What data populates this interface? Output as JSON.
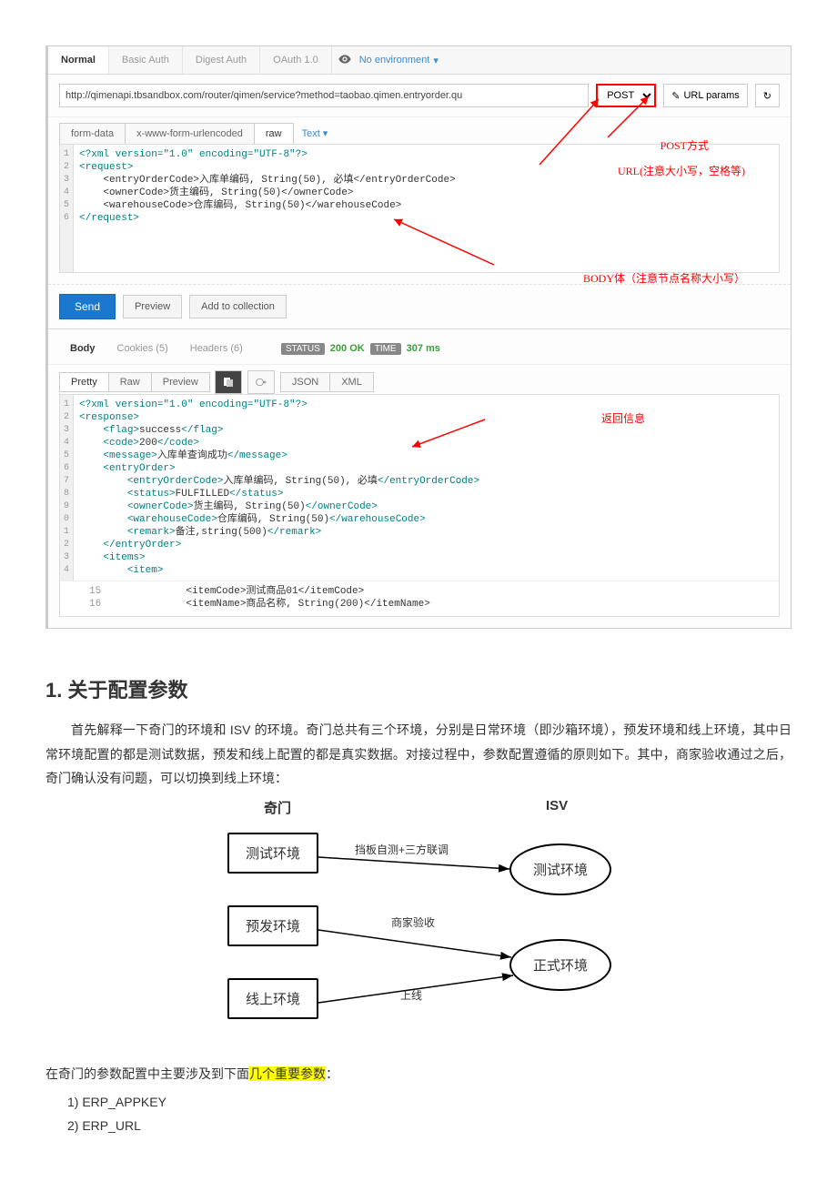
{
  "postman": {
    "tabs": {
      "normal": "Normal",
      "basic": "Basic Auth",
      "digest": "Digest Auth",
      "oauth": "OAuth 1.0"
    },
    "env": "No environment",
    "url": "http://qimenapi.tbsandbox.com/router/qimen/service?method=taobao.qimen.entryorder.qu",
    "method": "POST",
    "url_params_btn": "URL params",
    "body_tabs": {
      "form": "form-data",
      "urlenc": "x-www-form-urlencoded",
      "raw": "raw"
    },
    "body_type": "Text",
    "request_xml": {
      "decl": "<?xml version=\"1.0\" encoding=\"UTF-8\"?>",
      "l2": "<request>",
      "l3": "    <entryOrderCode>入库单编码, String(50), 必填</entryOrderCode>",
      "l4": "    <ownerCode>货主编码, String(50)</ownerCode>",
      "l5": "    <warehouseCode>仓库编码, String(50)</warehouseCode>",
      "l6": "</request>"
    },
    "send": "Send",
    "preview": "Preview",
    "add": "Add to collection",
    "resp_tabs": {
      "body": "Body",
      "cookies": "Cookies (5)",
      "headers": "Headers (6)"
    },
    "status_label": "STATUS",
    "status": "200 OK",
    "time_label": "TIME",
    "time": "307 ms",
    "fmt_tabs": {
      "pretty": "Pretty",
      "raw": "Raw",
      "preview": "Preview",
      "json": "JSON",
      "xml": "XML"
    },
    "response_xml_lines": [
      "<?xml version=\"1.0\" encoding=\"UTF-8\"?>",
      "<response>",
      "    <flag>success</flag>",
      "    <code>200</code>",
      "    <message>入库单查询成功</message>",
      "    <entryOrder>",
      "        <entryOrderCode>入库单编码, String(50), 必填</entryOrderCode>",
      "        <status>FULFILLED</status>",
      "        <ownerCode>货主编码, String(50)</ownerCode>",
      "        <warehouseCode>仓库编码, String(50)</warehouseCode>",
      "        <remark>备注,string(500)</remark>",
      "    </entryOrder>",
      "    <items>",
      "        <item>"
    ],
    "response_extra": [
      "            <itemCode>测试商品01</itemCode>",
      "            <itemName>商品名称, String(200)</itemName>"
    ],
    "response_extra_nums": [
      "15",
      "16"
    ]
  },
  "annotations": {
    "post": "POST方式",
    "url": "URL(注意大小写，空格等)",
    "body": "BODY体（注意节点名称大小写）",
    "resp": "返回信息"
  },
  "doc": {
    "h1_num": "1.",
    "h1": "关于配置参数",
    "p1": "首先解释一下奇门的环境和 ISV 的环境。奇门总共有三个环境，分别是日常环境（即沙箱环境），预发环境和线上环境，其中日常环境配置的都是测试数据，预发和线上配置的都是真实数据。对接过程中，参数配置遵循的原则如下。其中，商家验收通过之后，奇门确认没有问题，可以切换到线上环境：",
    "p2a": "在奇门的参数配置中主要涉及到下面",
    "p2b": "几个重要参数",
    "p2c": "：",
    "params": {
      "a": "1)  ERP_APPKEY",
      "b": "2)  ERP_URL"
    }
  },
  "diagram": {
    "qimen": "奇门",
    "isv": "ISV",
    "test": "测试环境",
    "pre": "预发环境",
    "online": "线上环境",
    "isv_test": "测试环境",
    "isv_prod": "正式环境",
    "lbl1": "挡板自测+三方联调",
    "lbl2": "商家验收",
    "lbl3": "上线"
  }
}
